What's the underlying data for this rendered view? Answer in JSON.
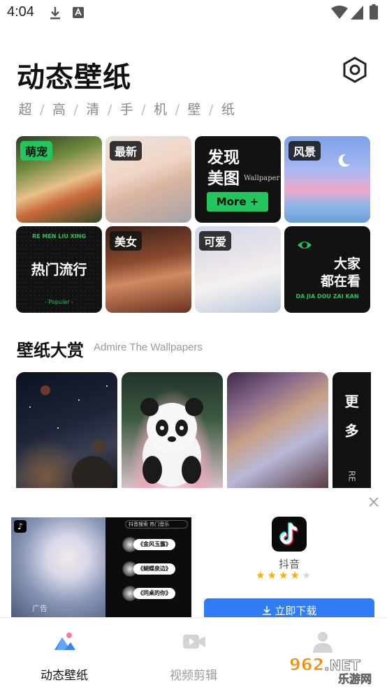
{
  "status_bar": {
    "time": "4:04"
  },
  "header": {
    "title": "动态壁纸",
    "subtitle_chars": [
      "超",
      "高",
      "清",
      "手",
      "机",
      "壁",
      "纸"
    ],
    "subtitle_separator": "/"
  },
  "categories": {
    "cute": "萌宠",
    "newest": "最新",
    "discover_line1": "发现",
    "discover_line2": "美图",
    "discover_en": "Wallpaper",
    "more_button": "More +",
    "scenery": "风景",
    "hot_en": "RE MEN LIU XING",
    "hot_cn": "热门流行",
    "hot_popular": "- Popular -",
    "beauty": "美女",
    "lovely": "可爱",
    "watch_line1": "大家",
    "watch_line2": "都在看",
    "watch_en": "DA JIA DOU ZAI KAN"
  },
  "section": {
    "title": "壁纸大赏",
    "subtitle": "Admire The Wallpapers",
    "more_line1": "更",
    "more_line2": "多",
    "more_en": "RE"
  },
  "ad": {
    "app_name": "抖音",
    "rating": 4,
    "rating_max": 5,
    "download_label": "立即下载",
    "ad_label": "广告",
    "search_text": "抖音搜索",
    "search_hot": "热门音乐",
    "songs": [
      "《金风玉露》",
      "《蝴蝶泉边》",
      "《同桌的你》"
    ]
  },
  "nav": {
    "items": [
      {
        "label": "动态壁纸",
        "active": true
      },
      {
        "label": "视频剪辑",
        "active": false
      }
    ]
  },
  "watermark": {
    "text1": "962",
    "text2": ".NET",
    "text3": "乐游网"
  },
  "colors": {
    "accent_green": "#22c55e",
    "download_blue": "#2f7cf6",
    "star": "#f5b301"
  }
}
